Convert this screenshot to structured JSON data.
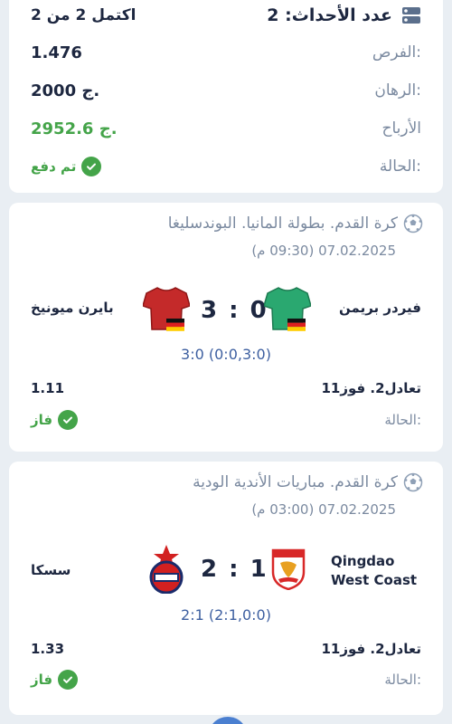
{
  "summary": {
    "events_label": "عدد الأحداث: 2",
    "completed_label": "اكتمل 2 من 2",
    "rows": [
      {
        "label": "الفرص:",
        "value": "1.476"
      },
      {
        "label": "الرهان:",
        "value": "2000 ج."
      },
      {
        "label": "الأرباح",
        "value": "2952.6 ج."
      }
    ],
    "status_label": "الحالة:",
    "status_value": "تم دفع"
  },
  "events": [
    {
      "tournament": "كرة القدم. بطولة المانيا. البوندسليغا",
      "datetime": "07.02.2025 (09:30 م)",
      "home": "فيردر بريمن",
      "away": "بايرن ميونيخ",
      "score": "3 : 0",
      "detail": "3:0 (0:0,3:0)",
      "selection": "1تعادل2. فوز1",
      "odds": "1.11",
      "status_label": "الحالة:",
      "status_value": "فاز"
    },
    {
      "tournament": "كرة القدم. مباريات الأندية الودية",
      "datetime": "07.02.2025 (03:00 م)",
      "home_line1": "Qingdao",
      "home_line2": "West Coast",
      "away": "سسكا",
      "score": "2 : 1",
      "detail": "2:1 (2:1,0:0)",
      "selection": "1تعادل2. فوز1",
      "odds": "1.33",
      "status_label": "الحالة:",
      "status_value": "فاز"
    }
  ],
  "colors": {
    "accent_green": "#44a449",
    "text_dark": "#1d2740",
    "text_muted": "#7b8aa0",
    "background": "#e9eef3"
  }
}
